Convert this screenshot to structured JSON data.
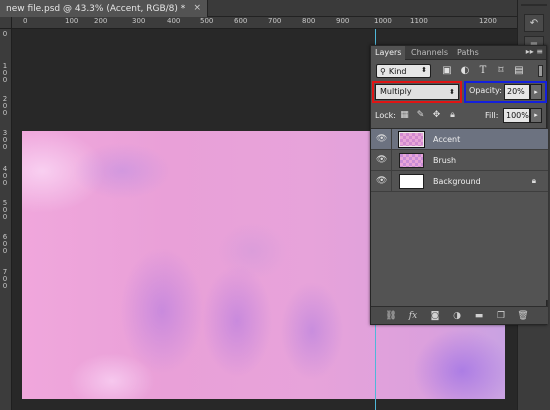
{
  "document": {
    "tab_title": "new file.psd @ 43.3% (Accent, RGB/8) *",
    "close_glyph": "×"
  },
  "ruler": {
    "top_labels": [
      "0",
      "100",
      "200",
      "300",
      "400",
      "500",
      "600",
      "700",
      "800",
      "900",
      "1000",
      "1100",
      "1200"
    ],
    "left_labels": [
      "0",
      "100",
      "200",
      "300",
      "400",
      "500",
      "600",
      "700"
    ]
  },
  "layers_panel": {
    "tabs": [
      "Layers",
      "Channels",
      "Paths"
    ],
    "active_tab": "Layers",
    "menu_glyph": "▸▸ ≡",
    "filter": {
      "kind_label": "Kind",
      "icons": [
        "image-filter-icon",
        "adjustment-filter-icon",
        "type-filter-icon",
        "shape-filter-icon",
        "smart-object-filter-icon"
      ]
    },
    "blend_mode": "Multiply",
    "opacity_label": "Opacity:",
    "opacity_value": "20%",
    "lock_label": "Lock:",
    "fill_label": "Fill:",
    "fill_value": "100%",
    "layers": [
      {
        "name": "Accent",
        "selected": true,
        "locked": false
      },
      {
        "name": "Brush",
        "selected": false,
        "locked": false
      },
      {
        "name": "Background",
        "selected": false,
        "locked": true
      }
    ],
    "footer_icons": [
      "link-icon",
      "fx-icon",
      "mask-icon",
      "adjustment-icon",
      "group-folder-icon",
      "new-layer-icon",
      "trash-icon"
    ]
  },
  "colors": {
    "highlight_blend": "#e01414",
    "highlight_opacity": "#1420dc",
    "guide": "#4fb7d8"
  }
}
